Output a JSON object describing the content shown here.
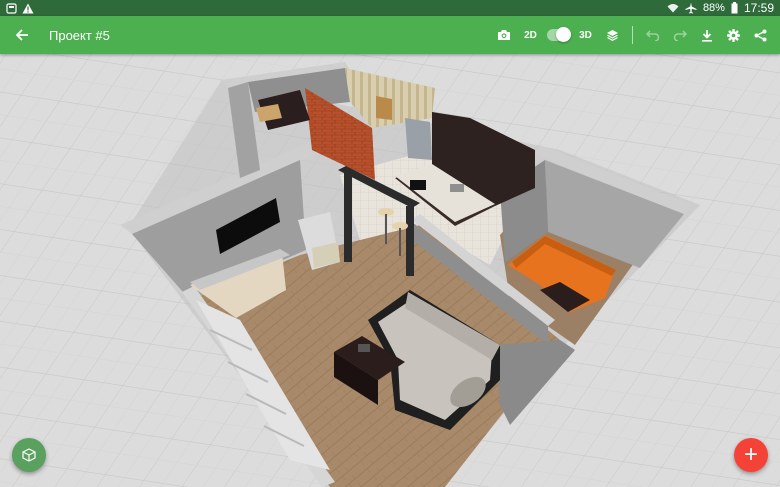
{
  "status_bar": {
    "battery": "88%",
    "time": "17:59",
    "icons": [
      "notification-icon",
      "warning-icon",
      "wifi-icon",
      "airplane-icon",
      "battery-icon"
    ]
  },
  "toolbar": {
    "title": "Проект #5",
    "view_2d_label": "2D",
    "view_3d_label": "3D",
    "view_mode": "3D",
    "icons": [
      "back-arrow-icon",
      "camera-icon",
      "layers-icon",
      "undo-icon",
      "redo-icon",
      "download-icon",
      "settings-icon",
      "share-icon"
    ]
  },
  "colors": {
    "status_bar": "#2f6b3a",
    "toolbar": "#4caf50",
    "fab_3d": "#5aa05e",
    "fab_add": "#f44336",
    "grid_bg": "#d9d9d9",
    "floor_wood": "#a68a6a",
    "wall_gray": "#9a9a9a",
    "sofa_orange": "#e8731e",
    "brick": "#b8502c"
  },
  "fab": {
    "add_label": "+"
  }
}
